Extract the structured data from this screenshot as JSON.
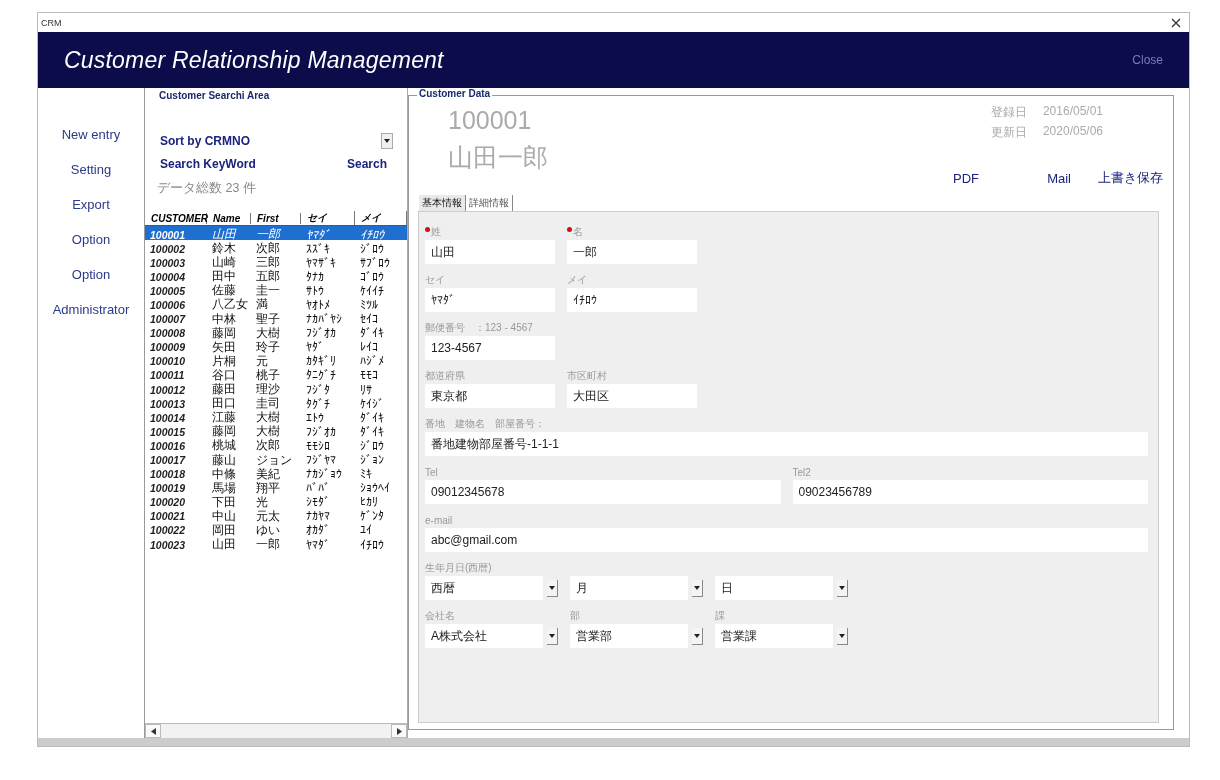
{
  "window": {
    "title": "CRM"
  },
  "header": {
    "title": "Customer Relationship Management",
    "close": "Close"
  },
  "nav": [
    "New entry",
    "Setting",
    "Export",
    "Option",
    "Option",
    "Administrator"
  ],
  "search_area": {
    "heading": "Customer Searchi Area",
    "sort": "Sort by CRMNO",
    "keyword_label": "Search KeyWord",
    "search_button": "Search",
    "count": "データ総数  23  件"
  },
  "table": {
    "columns": [
      "CUSTOMER",
      "Name",
      "First",
      "セイ",
      "メイ"
    ],
    "rows": [
      {
        "cells": [
          "100001",
          "山田",
          "一郎",
          "ﾔﾏﾀﾞ",
          "ｲﾁﾛｳ"
        ],
        "selected": true
      },
      {
        "cells": [
          "100002",
          "鈴木",
          "次郎",
          "ｽｽﾞｷ",
          "ｼﾞﾛｳ"
        ],
        "selected": false
      },
      {
        "cells": [
          "100003",
          "山崎",
          "三郎",
          "ﾔﾏｻﾞｷ",
          "ｻﾌﾞﾛｳ"
        ],
        "selected": false
      },
      {
        "cells": [
          "100004",
          "田中",
          "五郎",
          "ﾀﾅｶ",
          "ｺﾞﾛｳ"
        ],
        "selected": false
      },
      {
        "cells": [
          "100005",
          "佐藤",
          "圭一",
          "ｻﾄｳ",
          "ｹｲｲﾁ"
        ],
        "selected": false
      },
      {
        "cells": [
          "100006",
          "八乙女",
          "満",
          "ﾔｵﾄﾒ",
          "ﾐﾂﾙ"
        ],
        "selected": false
      },
      {
        "cells": [
          "100007",
          "中林",
          "聖子",
          "ﾅｶﾊﾞﾔｼ",
          "ｾｲｺ"
        ],
        "selected": false
      },
      {
        "cells": [
          "100008",
          "藤岡",
          "大樹",
          "ﾌｼﾞｵｶ",
          "ﾀﾞｲｷ"
        ],
        "selected": false
      },
      {
        "cells": [
          "100009",
          "矢田",
          "玲子",
          "ﾔﾀﾞ",
          "ﾚｲｺ"
        ],
        "selected": false
      },
      {
        "cells": [
          "100010",
          "片桐",
          "元",
          "ｶﾀｷﾞﾘ",
          "ﾊｼﾞﾒ"
        ],
        "selected": false
      },
      {
        "cells": [
          "100011",
          "谷口",
          "桃子",
          "ﾀﾆｸﾞﾁ",
          "ﾓﾓｺ"
        ],
        "selected": false
      },
      {
        "cells": [
          "100012",
          "藤田",
          "理沙",
          "ﾌｼﾞﾀ",
          "ﾘｻ"
        ],
        "selected": false
      },
      {
        "cells": [
          "100013",
          "田口",
          "圭司",
          "ﾀｸﾞﾁ",
          "ｹｲｼﾞ"
        ],
        "selected": false
      },
      {
        "cells": [
          "100014",
          "江藤",
          "大樹",
          "ｴﾄｳ",
          "ﾀﾞｲｷ"
        ],
        "selected": false
      },
      {
        "cells": [
          "100015",
          "藤岡",
          "大樹",
          "ﾌｼﾞｵｶ",
          "ﾀﾞｲｷ"
        ],
        "selected": false
      },
      {
        "cells": [
          "100016",
          "桃城",
          "次郎",
          "ﾓﾓｼﾛ",
          "ｼﾞﾛｳ"
        ],
        "selected": false
      },
      {
        "cells": [
          "100017",
          "藤山",
          "ジョン",
          "ﾌｼﾞﾔﾏ",
          "ｼﾞｮﾝ"
        ],
        "selected": false
      },
      {
        "cells": [
          "100018",
          "中條",
          "美紀",
          "ﾅｶｼﾞｮｳ",
          "ﾐｷ"
        ],
        "selected": false
      },
      {
        "cells": [
          "100019",
          "馬場",
          "翔平",
          "ﾊﾞﾊﾞ",
          "ｼｮｳﾍｲ"
        ],
        "selected": false
      },
      {
        "cells": [
          "100020",
          "下田",
          "光",
          "ｼﾓﾀﾞ",
          "ﾋｶﾘ"
        ],
        "selected": false
      },
      {
        "cells": [
          "100021",
          "中山",
          "元太",
          "ﾅｶﾔﾏ",
          "ｹﾞﾝﾀ"
        ],
        "selected": false
      },
      {
        "cells": [
          "100022",
          "岡田",
          "ゆい",
          "ｵｶﾀﾞ",
          "ﾕｲ"
        ],
        "selected": false
      },
      {
        "cells": [
          "100023",
          "山田",
          "一郎",
          "ﾔﾏﾀﾞ",
          "ｲﾁﾛｳ"
        ],
        "selected": false
      }
    ]
  },
  "customer": {
    "heading": "Customer Data",
    "id": "100001",
    "name": "山田一郎",
    "dates": [
      {
        "label": "登録日",
        "value": "2016/05/01"
      },
      {
        "label": "更新日",
        "value": "2020/05/06"
      }
    ],
    "actions": [
      "PDF",
      "Mail",
      "上書き保存"
    ],
    "tabs": [
      {
        "label": "基本情報",
        "selected": true
      },
      {
        "label": "詳細情報",
        "selected": false
      }
    ],
    "rows": [
      {
        "kind": "short",
        "fields": [
          {
            "label": "姓",
            "required": true,
            "value": "山田",
            "kind": "text"
          },
          {
            "label": "名",
            "required": true,
            "value": "一郎",
            "kind": "text"
          }
        ]
      },
      {
        "kind": "short",
        "fields": [
          {
            "label": "セイ",
            "required": false,
            "value": "ﾔﾏﾀﾞ",
            "kind": "text"
          },
          {
            "label": "メイ",
            "required": false,
            "value": "ｲﾁﾛｳ",
            "kind": "text"
          }
        ]
      },
      {
        "kind": "short",
        "fields": [
          {
            "label": "郵便番号　：123 - 4567",
            "required": false,
            "value": "123-4567",
            "kind": "text"
          }
        ]
      },
      {
        "kind": "short",
        "fields": [
          {
            "label": "都道府県",
            "required": false,
            "value": "東京都",
            "kind": "text"
          },
          {
            "label": "市区町村",
            "required": false,
            "value": "大田区",
            "kind": "text"
          }
        ]
      },
      {
        "kind": "full",
        "fields": [
          {
            "label": "番地　建物名　部屋番号：",
            "required": false,
            "value": "番地建物部屋番号-1-1-1",
            "kind": "text"
          }
        ]
      },
      {
        "kind": "half",
        "fields": [
          {
            "label": "Tel",
            "required": false,
            "value": "09012345678",
            "kind": "text"
          },
          {
            "label": "Tel2",
            "required": false,
            "value": "09023456789",
            "kind": "text"
          }
        ]
      },
      {
        "kind": "full",
        "fields": [
          {
            "label": "e-mail",
            "required": false,
            "value": "abc@gmail.com",
            "kind": "text"
          }
        ]
      },
      {
        "kind": "select",
        "fields": [
          {
            "label": "生年月日(西暦)",
            "required": false,
            "value": "西暦",
            "kind": "select"
          },
          {
            "value": "月",
            "required": false,
            "kind": "select"
          },
          {
            "value": "日",
            "required": false,
            "kind": "select"
          }
        ]
      },
      {
        "kind": "select",
        "fields": [
          {
            "label": "会社名",
            "required": false,
            "value": "A株式会社",
            "kind": "select"
          },
          {
            "label": "部",
            "required": false,
            "value": "営業部",
            "kind": "select"
          },
          {
            "label": "課",
            "required": false,
            "value": "営業課",
            "kind": "select"
          }
        ]
      }
    ]
  }
}
